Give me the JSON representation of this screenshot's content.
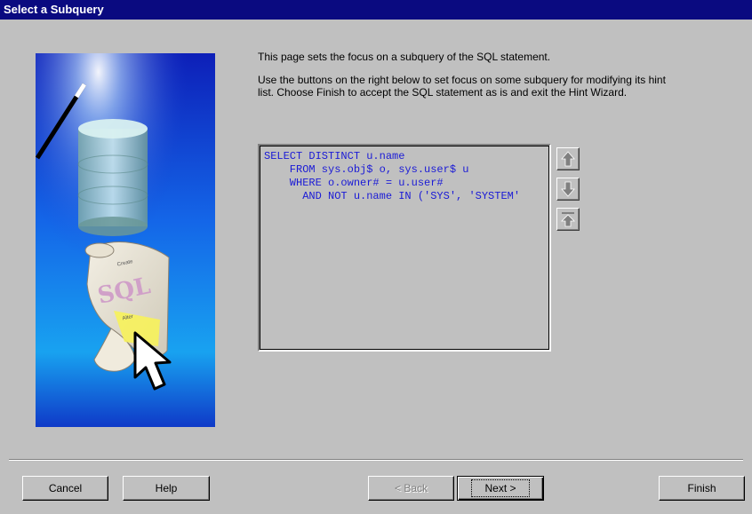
{
  "window": {
    "title": "Select a Subquery"
  },
  "description": {
    "line1": "This page sets the focus on a subquery of the SQL statement.",
    "line2": "Use the buttons on the right below to set focus on some subquery for modifying its hint list.  Choose Finish to accept the SQL statement as is and exit the Hint Wizard."
  },
  "sql_statement": "SELECT DISTINCT u.name\n    FROM sys.obj$ o, sys.user$ u\n    WHERE o.owner# = u.user#\n      AND NOT u.name IN ('SYS', 'SYSTEM'",
  "illustration": {
    "scroll_text": "SQL",
    "scroll_lines": [
      "Create",
      "Alter"
    ]
  },
  "navigation_buttons": [
    {
      "icon": "arrow-up-icon"
    },
    {
      "icon": "arrow-down-icon"
    },
    {
      "icon": "arrow-to-top-icon"
    }
  ],
  "buttons": {
    "cancel": "Cancel",
    "help": "Help",
    "back": "< Back",
    "next": "Next >",
    "finish": "Finish"
  },
  "colors": {
    "title_bar": "#0a0a80",
    "sql_text": "#1a1ad6",
    "dialog_bg": "#c0c0c0"
  }
}
